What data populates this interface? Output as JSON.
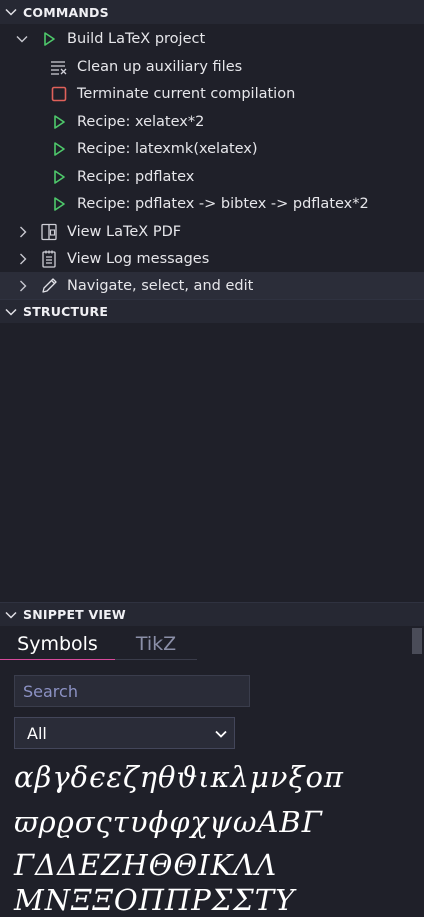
{
  "commands": {
    "header": "COMMANDS",
    "build": "Build LaTeX project",
    "clean": "Clean up auxiliary files",
    "terminate": "Terminate current compilation",
    "recipes": [
      "Recipe: xelatex*2",
      "Recipe: latexmk(xelatex)",
      "Recipe: pdflatex",
      "Recipe: pdflatex -> bibtex -> pdflatex*2"
    ],
    "view_pdf": "View LaTeX PDF",
    "view_log": "View Log messages",
    "navigate": "Navigate, select, and edit"
  },
  "structure": {
    "header": "STRUCTURE"
  },
  "snippet": {
    "header": "SNIPPET VIEW",
    "tabs": [
      "Symbols",
      "TikZ"
    ],
    "search_placeholder": "Search",
    "filter_value": "All",
    "symbol_rows": [
      "αβγδϵεζηθϑικλμνξοπ",
      "ϖρϱσςτυϕφχψωABΓ",
      "ΓΔΔEZHΘΘIKΛΛ",
      "MNΞΞOΠΠPΣΣTΥ"
    ]
  },
  "colors": {
    "play": "#4ec96b",
    "stop": "#e0615a",
    "accent": "#d64b9c"
  }
}
